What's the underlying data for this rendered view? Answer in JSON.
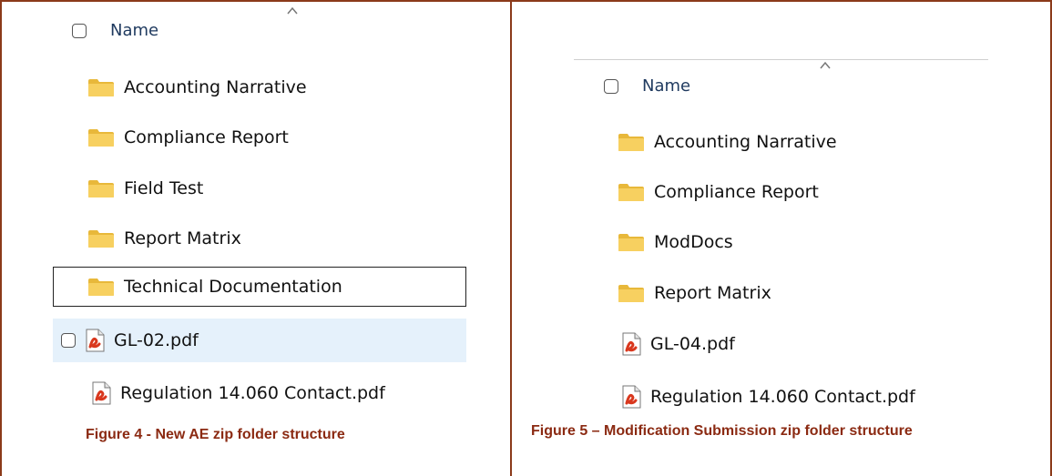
{
  "left": {
    "header_label": "Name",
    "items": [
      {
        "type": "folder",
        "label": "Accounting Narrative"
      },
      {
        "type": "folder",
        "label": "Compliance Report"
      },
      {
        "type": "folder",
        "label": "Field Test"
      },
      {
        "type": "folder",
        "label": "Report Matrix"
      },
      {
        "type": "folder",
        "label": "Technical Documentation",
        "state": "focused"
      },
      {
        "type": "pdf",
        "label": "GL-02.pdf",
        "state": "hovered"
      },
      {
        "type": "pdf",
        "label": "Regulation 14.060 Contact.pdf"
      }
    ],
    "caption": "Figure 4 - New AE zip folder structure"
  },
  "right": {
    "header_label": "Name",
    "items": [
      {
        "type": "folder",
        "label": "Accounting Narrative"
      },
      {
        "type": "folder",
        "label": "Compliance Report"
      },
      {
        "type": "folder",
        "label": "ModDocs"
      },
      {
        "type": "folder",
        "label": "Report Matrix"
      },
      {
        "type": "pdf",
        "label": "GL-04.pdf"
      },
      {
        "type": "pdf",
        "label": "Regulation 14.060 Contact.pdf"
      }
    ],
    "caption": "Figure 5 – Modification Submission zip folder structure"
  },
  "colors": {
    "border": "#8b3a1a",
    "caption": "#8b2a12",
    "header_text": "#1f3a5f",
    "hover": "#e5f1fb",
    "folder": "#f2c94c",
    "pdf_red": "#d9381e"
  },
  "icons": {
    "folder": "folder-icon",
    "pdf": "pdf-file-icon",
    "sort": "sort-caret-up-icon",
    "checkbox": "checkbox-icon"
  }
}
